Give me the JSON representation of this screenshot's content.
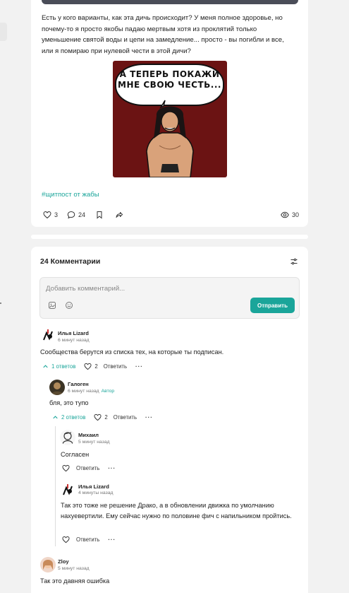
{
  "post": {
    "text": "Есть у кого варианты, как эта дичь происходит? У меня полное здоровье, но почему-то я просто якобы падаю мертвым хотя из проклятий только уменьшение святой воды и цепи на замедление... просто - вы погибли и все, или я помираю при нулевой чести в этой дичи?",
    "image": {
      "caption": "А ТЕПЕРЬ ПОКАЖИ МНЕ СВОЮ ЧЕСТЬ...",
      "icon": "warrior-meme-image"
    },
    "hashtag": "#щитпост от жабы",
    "likes": "3",
    "comments": "24",
    "views": "30"
  },
  "comments_section": {
    "title": "24 Комментарии",
    "input_placeholder": "Добавить комментарий...",
    "send_label": "Отправить",
    "reply_label": "Ответить",
    "comments": [
      {
        "author": "Илья Lizard",
        "time": "6 минут назад",
        "text": "Сообщества берутся из списка тех, на которые ты подписан.",
        "replies": "1 ответов",
        "likes": "2"
      },
      {
        "author": "Галоген",
        "time": "6 минут назад",
        "badge": "Автор",
        "text": "бля, это тупо",
        "replies": "2 ответов",
        "likes": "2"
      },
      {
        "author": "Михаил",
        "time": "5 минут назад",
        "text": "Согласен"
      },
      {
        "author": "Илья Lizard",
        "time": "4 минуты назад",
        "text": "Так это тоже не решение Драко, а в обновлении движка по умолчанию нахуевертили. Ему сейчас нужно по половине фич с напильником пройтись."
      },
      {
        "author": "Zloy",
        "time": "5 минут назад",
        "text": "Так это давняя ошибка"
      }
    ]
  },
  "colors": {
    "accent": "#1aa59a",
    "meme_bg": "#6b1313"
  }
}
